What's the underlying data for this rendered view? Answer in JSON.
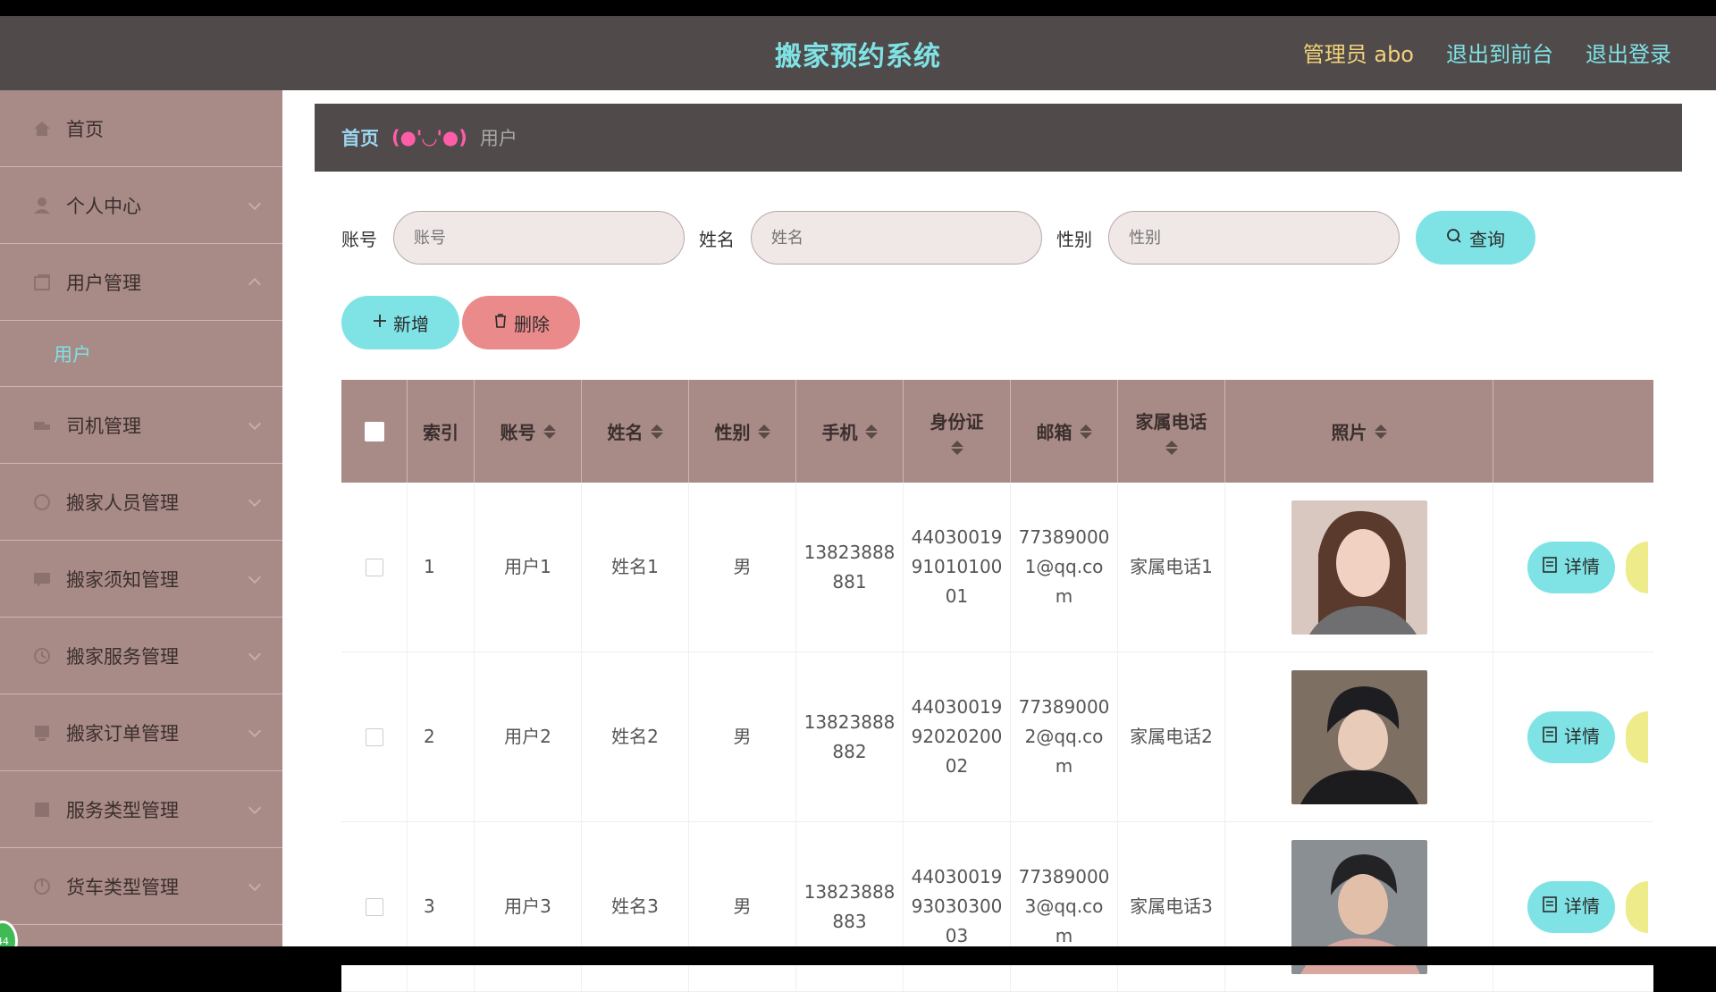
{
  "header": {
    "title": "搬家预约系统",
    "admin": "管理员 abo",
    "to_front": "退出到前台",
    "logout": "退出登录"
  },
  "sidebar": {
    "items": [
      {
        "label": "首页",
        "icon": "home-icon"
      },
      {
        "label": "个人中心",
        "icon": "user-icon"
      },
      {
        "label": "用户管理",
        "icon": "folder-icon",
        "expanded": true
      },
      {
        "label": "司机管理",
        "icon": "truck-icon"
      },
      {
        "label": "搬家人员管理",
        "icon": "people-icon"
      },
      {
        "label": "搬家须知管理",
        "icon": "notice-icon"
      },
      {
        "label": "搬家服务管理",
        "icon": "service-icon"
      },
      {
        "label": "搬家订单管理",
        "icon": "order-icon"
      },
      {
        "label": "服务类型管理",
        "icon": "category-icon"
      },
      {
        "label": "货车类型管理",
        "icon": "truck-type-icon"
      }
    ],
    "sub_item": "用户",
    "badge": "44"
  },
  "breadcrumb": {
    "home": "首页",
    "face": "(●'◡'●)",
    "current": "用户"
  },
  "search": {
    "account_label": "账号",
    "account_placeholder": "账号",
    "name_label": "姓名",
    "name_placeholder": "姓名",
    "gender_label": "性别",
    "gender_placeholder": "性别",
    "query_button": "查询"
  },
  "actions": {
    "add": "新增",
    "delete": "删除"
  },
  "table": {
    "headers": [
      "索引",
      "账号",
      "姓名",
      "性别",
      "手机",
      "身份证",
      "邮箱",
      "家属电话",
      "照片"
    ],
    "rows": [
      {
        "index": "1",
        "account": "用户1",
        "name": "姓名1",
        "gender": "男",
        "phone": "13823888881",
        "id_card": "440300199101010001",
        "email": "773890001@qq.com",
        "family_phone": "家属电话1",
        "detail": "详情"
      },
      {
        "index": "2",
        "account": "用户2",
        "name": "姓名2",
        "gender": "男",
        "phone": "13823888882",
        "id_card": "440300199202020002",
        "email": "773890002@qq.com",
        "family_phone": "家属电话2",
        "detail": "详情"
      },
      {
        "index": "3",
        "account": "用户3",
        "name": "姓名3",
        "gender": "男",
        "phone": "13823888883",
        "id_card": "440300199303030003",
        "email": "773890003@qq.com",
        "family_phone": "家属电话3",
        "detail": "详情"
      }
    ]
  },
  "colors": {
    "header_bg": "#504a4a",
    "accent": "#7fe3e6",
    "sidebar_bg": "#a88a86",
    "danger": "#ea8a8a"
  }
}
